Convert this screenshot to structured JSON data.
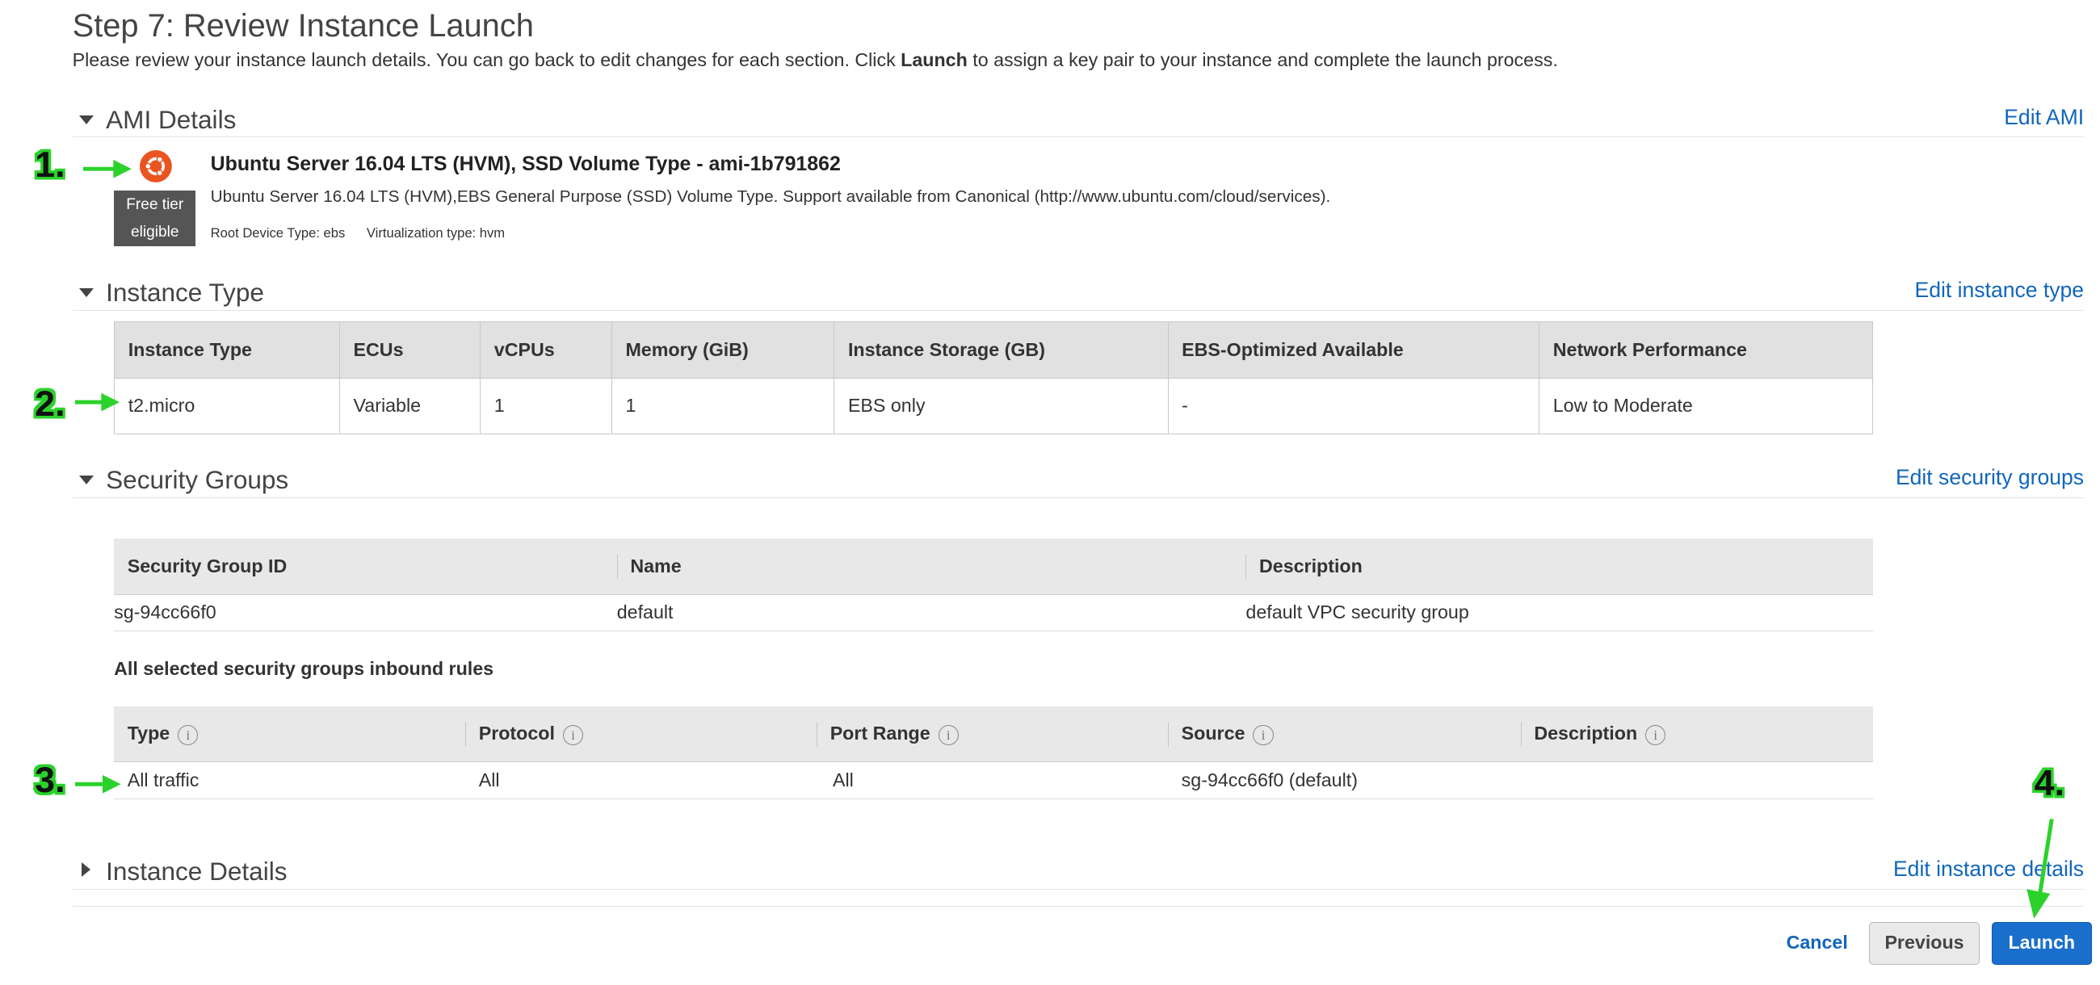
{
  "page": {
    "title": "Step 7: Review Instance Launch",
    "intro_before": "Please review your instance launch details. You can go back to edit changes for each section. Click ",
    "intro_bold": "Launch",
    "intro_after": " to assign a key pair to your instance and complete the launch process."
  },
  "ami": {
    "section_title": "AMI Details",
    "edit_label": "Edit AMI",
    "name": "Ubuntu Server 16.04 LTS (HVM), SSD Volume Type - ami-1b791862",
    "description": "Ubuntu Server 16.04 LTS (HVM),EBS General Purpose (SSD) Volume Type. Support available from Canonical (http://www.ubuntu.com/cloud/services).",
    "root_device": "Root Device Type: ebs",
    "virtualization": "Virtualization type: hvm",
    "badge_line1": "Free tier",
    "badge_line2": "eligible",
    "icon": "ubuntu-logo-icon",
    "icon_color": "#e95420"
  },
  "instance_type": {
    "section_title": "Instance Type",
    "edit_label": "Edit instance type",
    "headers": [
      "Instance Type",
      "ECUs",
      "vCPUs",
      "Memory (GiB)",
      "Instance Storage (GB)",
      "EBS-Optimized Available",
      "Network Performance"
    ],
    "row": [
      "t2.micro",
      "Variable",
      "1",
      "1",
      "EBS only",
      "-",
      "Low to Moderate"
    ]
  },
  "security_groups": {
    "section_title": "Security Groups",
    "edit_label": "Edit security groups",
    "headers": [
      "Security Group ID",
      "Name",
      "Description"
    ],
    "row": [
      "sg-94cc66f0",
      "default",
      "default VPC security group"
    ],
    "inbound_title": "All selected security groups inbound rules",
    "inbound_headers": [
      "Type",
      "Protocol",
      "Port Range",
      "Source",
      "Description"
    ],
    "inbound_row": [
      "All traffic",
      "All",
      "All",
      "sg-94cc66f0 (default)",
      ""
    ]
  },
  "instance_details": {
    "section_title": "Instance Details",
    "edit_label": "Edit instance details"
  },
  "footer": {
    "cancel": "Cancel",
    "previous": "Previous",
    "launch": "Launch"
  },
  "annotations": {
    "markers": [
      "1.",
      "2.",
      "3.",
      "4."
    ],
    "arrow_color": "#2bd22b"
  },
  "colors": {
    "link": "#1166bb",
    "launch_button": "#1a6fcd",
    "badge_bg": "#555555"
  }
}
